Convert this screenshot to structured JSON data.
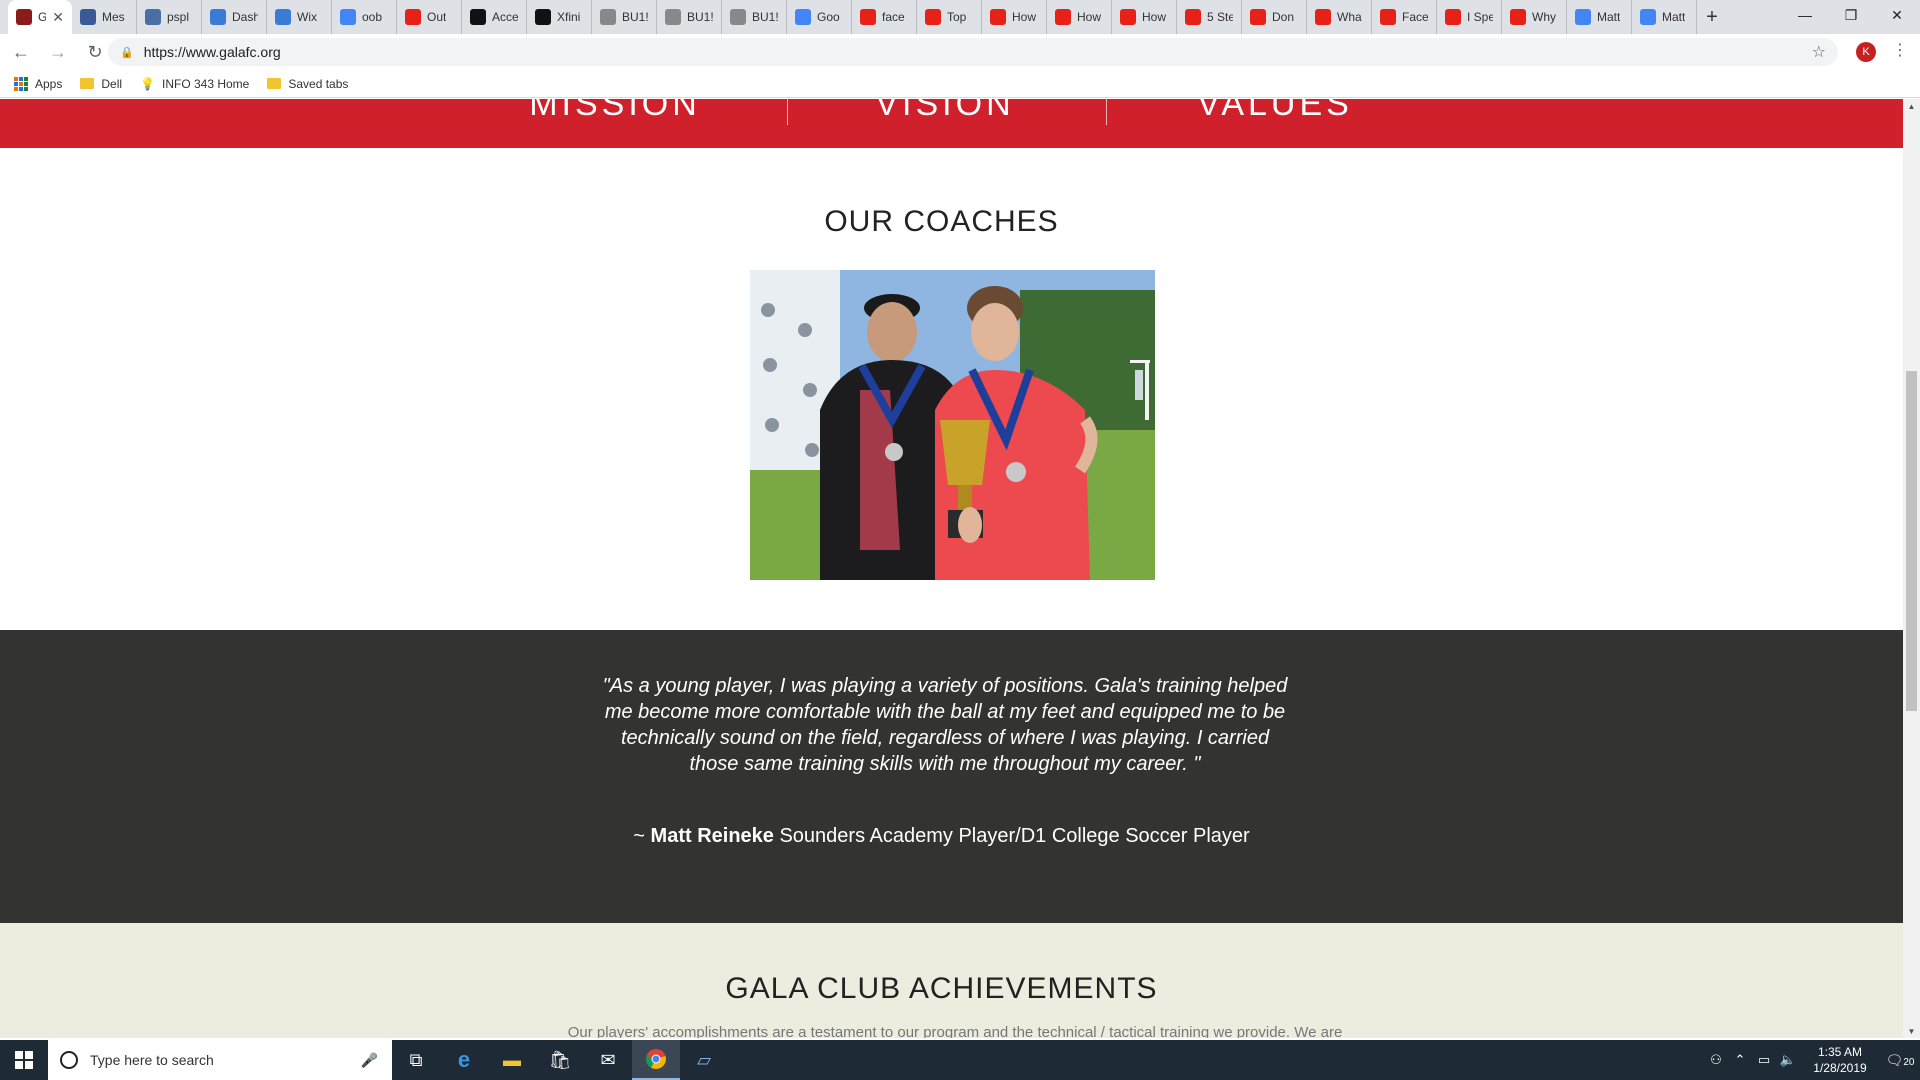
{
  "browser": {
    "tabs": [
      {
        "label": "G",
        "icon": "shield-favicon",
        "color": "#8b1a1a",
        "active": true
      },
      {
        "label": "Mes",
        "icon": "facebook-favicon",
        "color": "#3b5998"
      },
      {
        "label": "pspl",
        "icon": "globe-favicon",
        "color": "#4a6fa5"
      },
      {
        "label": "Dash",
        "icon": "x-favicon",
        "color": "#3a7bd5"
      },
      {
        "label": "Wix",
        "icon": "x-favicon",
        "color": "#3a7bd5"
      },
      {
        "label": "oob",
        "icon": "google-favicon",
        "color": "#4285f4"
      },
      {
        "label": "Out",
        "icon": "youtube-favicon",
        "color": "#e62117"
      },
      {
        "label": "Acce",
        "icon": "x-black-favicon",
        "color": "#111111"
      },
      {
        "label": "Xfini",
        "icon": "x-black-favicon",
        "color": "#111111"
      },
      {
        "label": "BU1!",
        "icon": "document-favicon",
        "color": "#888888"
      },
      {
        "label": "BU1!",
        "icon": "document-favicon",
        "color": "#888888"
      },
      {
        "label": "BU1!",
        "icon": "document-favicon",
        "color": "#888888"
      },
      {
        "label": "Goo",
        "icon": "google-favicon",
        "color": "#4285f4"
      },
      {
        "label": "face",
        "icon": "youtube-favicon",
        "color": "#e62117"
      },
      {
        "label": "Top",
        "icon": "youtube-favicon",
        "color": "#e62117"
      },
      {
        "label": "How",
        "icon": "youtube-favicon",
        "color": "#e62117"
      },
      {
        "label": "How",
        "icon": "youtube-favicon",
        "color": "#e62117"
      },
      {
        "label": "How",
        "icon": "youtube-favicon",
        "color": "#e62117"
      },
      {
        "label": "5 Ste",
        "icon": "youtube-favicon",
        "color": "#e62117"
      },
      {
        "label": "Don",
        "icon": "youtube-favicon",
        "color": "#e62117"
      },
      {
        "label": "Wha",
        "icon": "youtube-favicon",
        "color": "#e62117"
      },
      {
        "label": "Face",
        "icon": "youtube-favicon",
        "color": "#e62117"
      },
      {
        "label": "I Spe",
        "icon": "youtube-favicon",
        "color": "#e62117"
      },
      {
        "label": "Why",
        "icon": "youtube-favicon",
        "color": "#e62117"
      },
      {
        "label": "Matt",
        "icon": "google-favicon",
        "color": "#4285f4"
      },
      {
        "label": "Matt",
        "icon": "google-favicon",
        "color": "#4285f4"
      }
    ],
    "url": "https://www.galafc.org",
    "profile_initial": "K",
    "bookmarks": [
      {
        "label": "Apps",
        "icon": "apps-grid-icon"
      },
      {
        "label": "Dell",
        "icon": "folder-icon"
      },
      {
        "label": "INFO 343 Home",
        "icon": "lightbulb-icon"
      },
      {
        "label": "Saved tabs",
        "icon": "folder-icon"
      }
    ]
  },
  "page": {
    "band_color": "#d0202b",
    "pillars": [
      "MISSION",
      "VISION",
      "VALUES"
    ],
    "coaches": {
      "title": "OUR COACHES"
    },
    "testimonial": {
      "quote": "\"As a young player, I was playing a variety of positions. Gala's training helped me become more comfortable with the ball at my feet and equipped me to be technically sound on the field, regardless of where I was playing. I carried those same training skills with me throughout my career. \"",
      "prefix": "~ ",
      "author": "Matt Reineke",
      "role": " Sounders Academy Player/D1 College Soccer Player"
    },
    "achievements": {
      "title": "GALA CLUB ACHIEVEMENTS",
      "intro": "Our players' accomplishments are a testament to our program and the technical / tactical training we provide.  We are"
    }
  },
  "taskbar": {
    "search_placeholder": "Type here to search",
    "time": "1:35 AM",
    "date": "1/28/2019",
    "notifications": "20"
  }
}
